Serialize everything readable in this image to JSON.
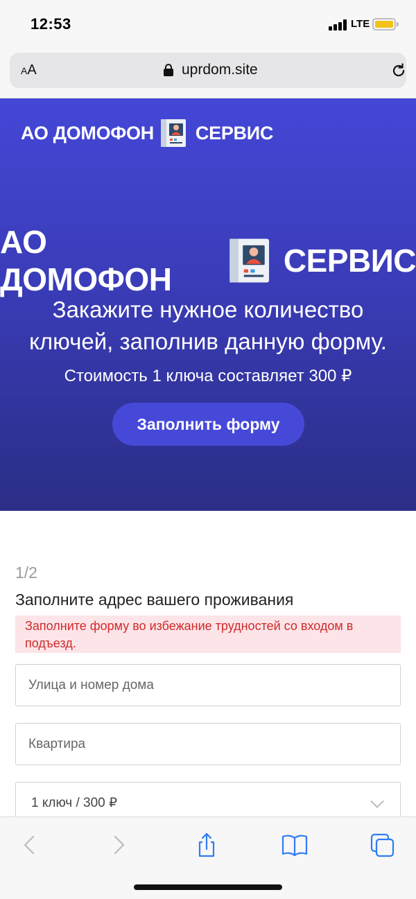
{
  "status_bar": {
    "time": "12:53",
    "network": "LTE",
    "battery_color": "#f2c21b"
  },
  "browser": {
    "text_size_label": "AA",
    "url": "uprdom.site",
    "icons": [
      "lock-icon",
      "reload-icon"
    ]
  },
  "hero": {
    "logo_left": "АО ДОМОФОН",
    "logo_right": "СЕРВИС",
    "title": "Закажите нужное количество ключей, заполнив данную форму.",
    "price_text": "Стоимость 1 ключа составляет 300 ₽",
    "button_label": "Заполнить форму",
    "colors": {
      "gradient_top": "#4447d6",
      "gradient_bottom": "#2b2d86",
      "button": "#4649d8"
    }
  },
  "form": {
    "step": "1/2",
    "title": "Заполните адрес вашего проживания",
    "alert": "Заполните форму во избежание трудностей со входом в подъезд.",
    "street_placeholder": "Улица и номер дома",
    "apartment_placeholder": "Квартира",
    "keys_select_value": "1 ключ / 300 ₽"
  },
  "toolbar": {
    "icons": [
      "back-icon",
      "forward-icon",
      "share-icon",
      "bookmarks-icon",
      "tabs-icon"
    ]
  }
}
